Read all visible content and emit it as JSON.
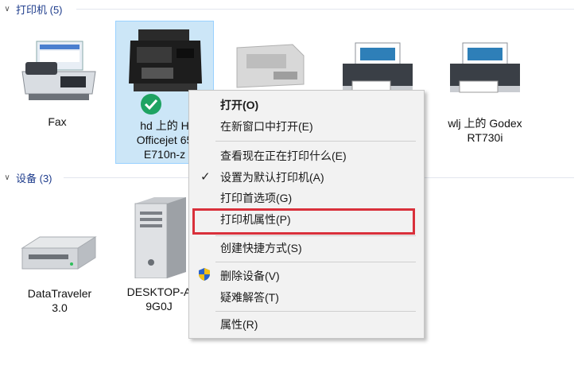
{
  "groups": {
    "printers": {
      "label": "打印机 (5)"
    },
    "devices": {
      "label": "设备 (3)"
    }
  },
  "printers": [
    {
      "name_line1": "Fax"
    },
    {
      "name_line1": "hd 上的 H",
      "name_line2": "Officejet 65",
      "name_line3": "E710n-z",
      "status_icon": "check-icon",
      "status_color": "#1ea362"
    },
    {
      "name_line1": ""
    },
    {
      "name_line1": ""
    },
    {
      "name_line1": "wlj 上的 Godex",
      "name_line2": "RT730i"
    }
  ],
  "devices": [
    {
      "name_line1": "DataTraveler",
      "name_line2": "3.0"
    },
    {
      "name_line1": "DESKTOP-A",
      "name_line2": "9G0J"
    }
  ],
  "context_menu": {
    "items": [
      {
        "label": "打开(O)",
        "bold": true
      },
      {
        "label": "在新窗口中打开(E)"
      },
      {
        "label": "查看现在正在打印什么(E)"
      },
      {
        "label": "设置为默认打印机(A)",
        "checked": true
      },
      {
        "label": "打印首选项(G)"
      },
      {
        "label": "打印机属性(P)",
        "highlighted": true
      },
      {
        "label": "创建快捷方式(S)"
      },
      {
        "label": "删除设备(V)",
        "icon": "shield-icon"
      },
      {
        "label": "疑难解答(T)"
      },
      {
        "label": "属性(R)"
      }
    ]
  },
  "colors": {
    "highlight_border": "#d9303b",
    "selection_bg": "#cce6f7",
    "group_header": "#1e3c8c"
  }
}
